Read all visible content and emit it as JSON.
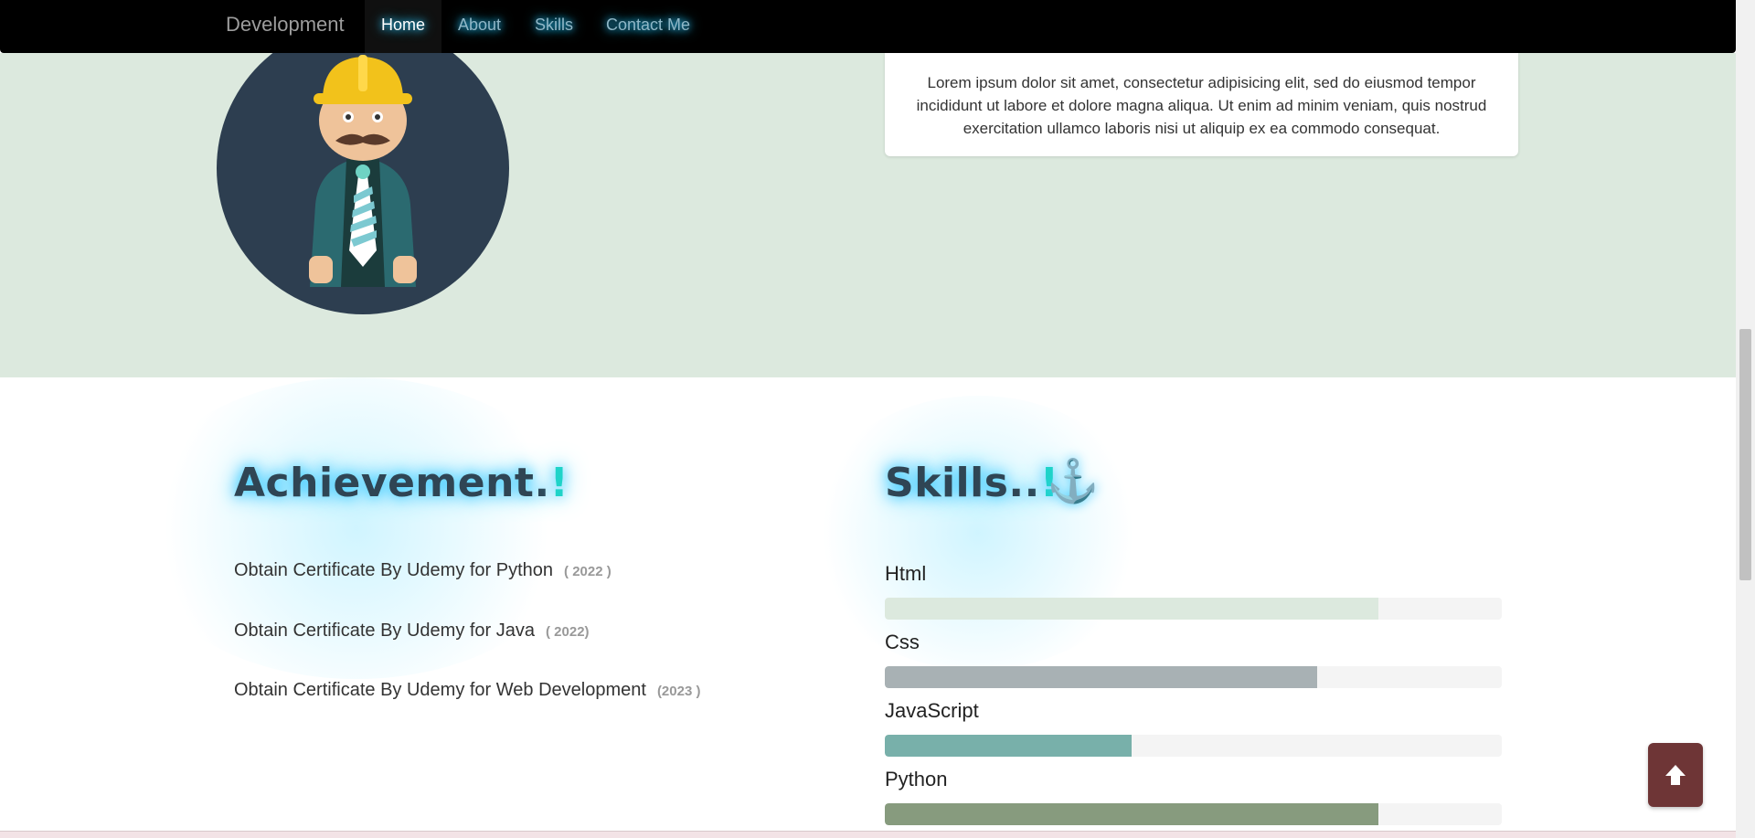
{
  "navbar": {
    "brand": "Development",
    "items": [
      {
        "label": "Home",
        "active": true
      },
      {
        "label": "About",
        "active": false
      },
      {
        "label": "Skills",
        "active": false
      },
      {
        "label": "Contact Me",
        "active": false
      }
    ]
  },
  "hero": {
    "avatar_icon": "construction-worker-avatar",
    "card_text": "Lorem ipsum dolor sit amet, consectetur adipisicing elit, sed do eiusmod tempor incididunt ut labore et dolore magna aliqua. Ut enim ad minim veniam, quis nostrud exercitation ullamco laboris nisi ut aliquip ex ea commodo consequat."
  },
  "achievement": {
    "title": "Achievement.",
    "title_mark": "!",
    "items": [
      {
        "text": "Obtain Certificate By Udemy for Python",
        "year": "( 2022 )"
      },
      {
        "text": "Obtain Certificate By Udemy for Java",
        "year": "( 2022)"
      },
      {
        "text": "Obtain Certificate By Udemy for Web Development",
        "year": "(2023 )"
      }
    ]
  },
  "skills": {
    "title": "Skills..",
    "title_mark": "!",
    "icon": "anchor-icon",
    "items": [
      {
        "label": "Html",
        "percent": 80,
        "color": "#dce9de"
      },
      {
        "label": "Css",
        "percent": 70,
        "color": "#a8b1b4"
      },
      {
        "label": "JavaScript",
        "percent": 40,
        "color": "#78b0aa"
      },
      {
        "label": "Python",
        "percent": 80,
        "color": "#879b7e"
      }
    ]
  },
  "back_to_top": {
    "icon": "arrow-up-icon"
  },
  "colors": {
    "accent_glow": "#3dcbff",
    "mark": "#1fd3c8",
    "button": "#6e3536"
  }
}
